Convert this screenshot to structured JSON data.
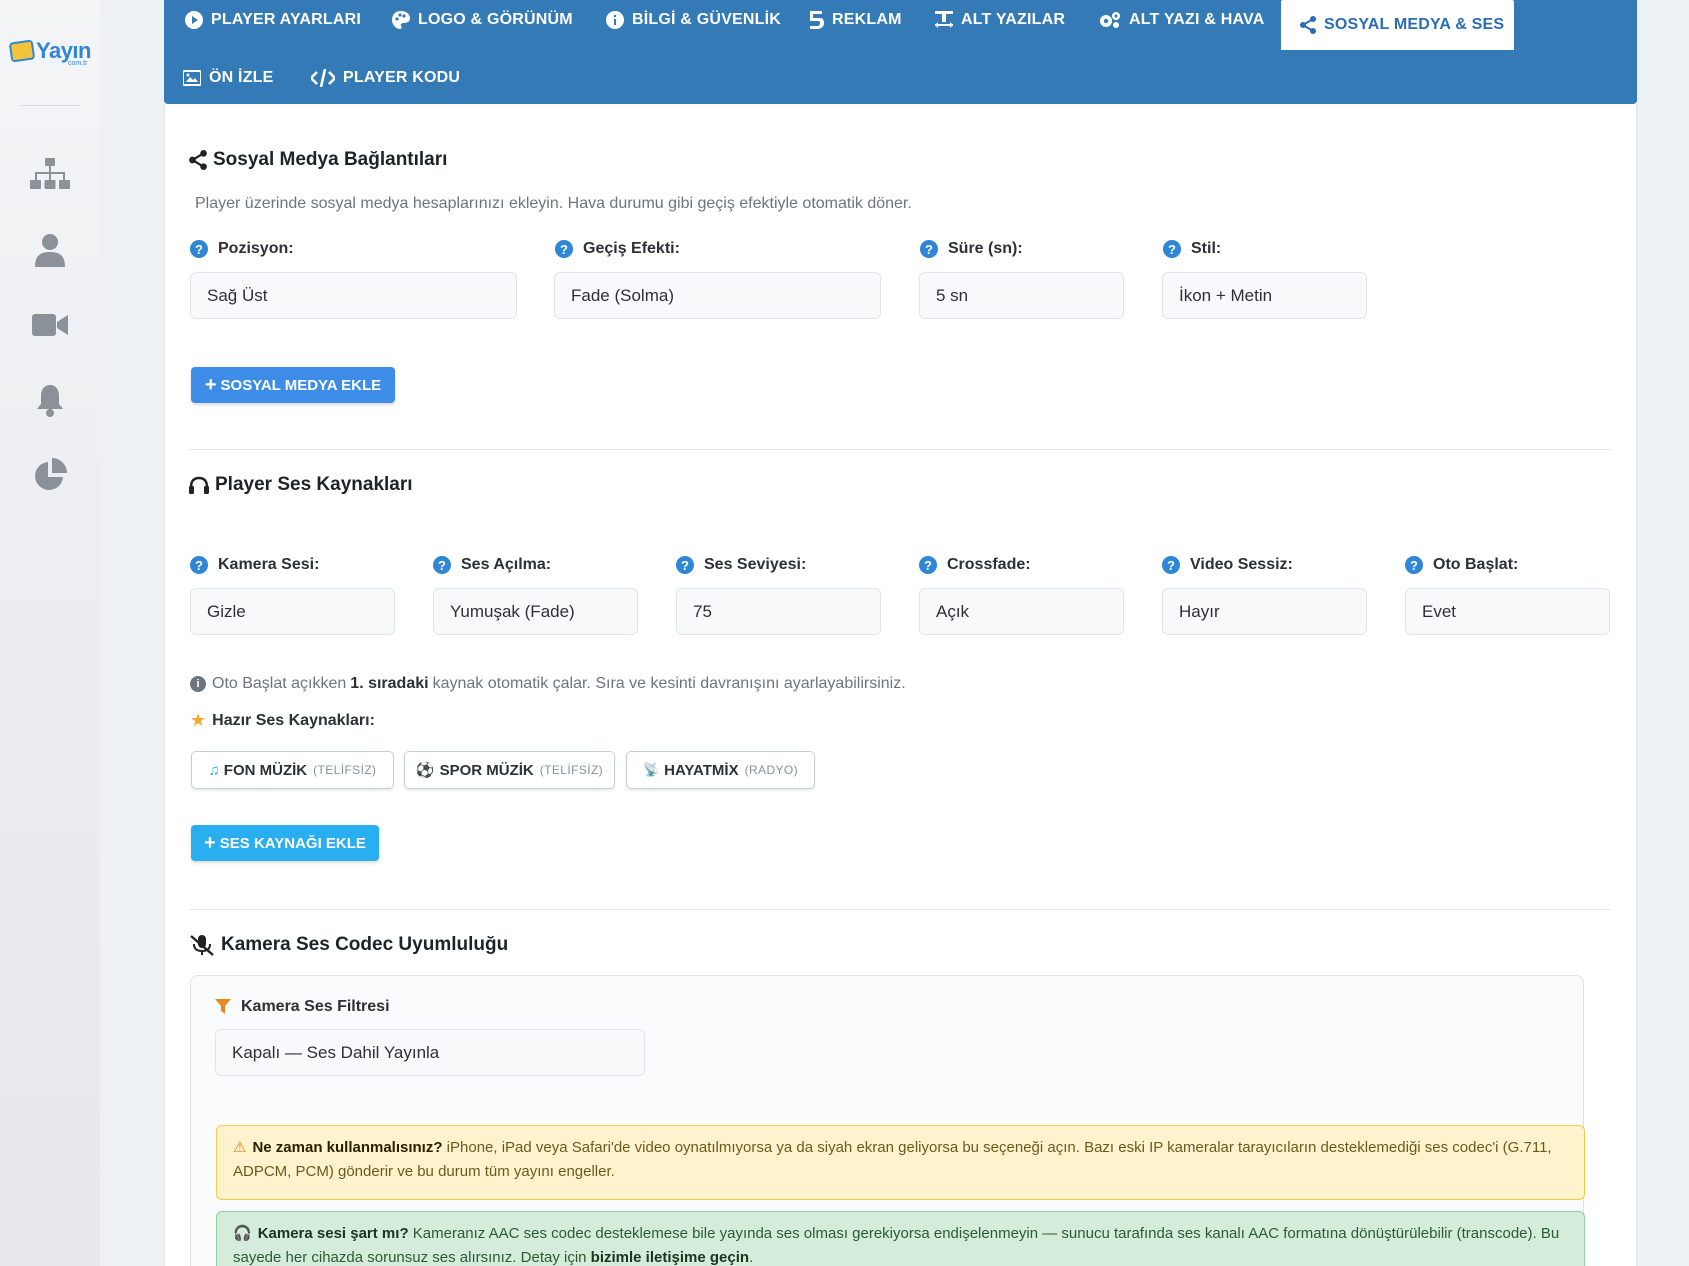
{
  "sidebar": {
    "logo_text": "Yayın",
    "logo_sub": "com.tr",
    "icons": [
      "sitemap-icon",
      "user-icon",
      "video-camera-icon",
      "bell-icon",
      "pie-chart-icon"
    ]
  },
  "tabs": [
    {
      "label": "PLAYER AYARLARI",
      "icon": "play-circle-icon"
    },
    {
      "label": "LOGO & GÖRÜNÜM",
      "icon": "palette-icon"
    },
    {
      "label": "BİLGİ & GÜVENLİK",
      "icon": "info-circle-icon"
    },
    {
      "label": "REKLAM",
      "icon": "ad-icon"
    },
    {
      "label": "ALT YAZILAR",
      "icon": "text-icon"
    },
    {
      "label": "ALT YAZI & HAVA",
      "icon": "cogs-icon"
    },
    {
      "label": "SOSYAL MEDYA & SES",
      "icon": "share-icon",
      "active": true
    },
    {
      "label": "ÖN İZLE",
      "icon": "image-icon"
    },
    {
      "label": "PLAYER KODU",
      "icon": "code-icon"
    }
  ],
  "social": {
    "title": "Sosyal Medya Bağlantıları",
    "description": "Player üzerinde sosyal medya hesaplarınızı ekleyin. Hava durumu gibi geçiş efektiyle otomatik döner.",
    "fields": [
      {
        "label": "Pozisyon:",
        "value": "Sağ Üst"
      },
      {
        "label": "Geçiş Efekti:",
        "value": "Fade (Solma)"
      },
      {
        "label": "Süre (sn):",
        "value": "5 sn"
      },
      {
        "label": "Stil:",
        "value": "İkon + Metin"
      }
    ],
    "add_button": "SOSYAL MEDYA EKLE"
  },
  "audio": {
    "title": "Player Ses Kaynakları",
    "fields": [
      {
        "label": "Kamera Sesi:",
        "value": "Gizle"
      },
      {
        "label": "Ses Açılma:",
        "value": "Yumuşak (Fade)"
      },
      {
        "label": "Ses Seviyesi:",
        "value": "75"
      },
      {
        "label": "Crossfade:",
        "value": "Açık"
      },
      {
        "label": "Video Sessiz:",
        "value": "Hayır"
      },
      {
        "label": "Oto Başlat:",
        "value": "Evet"
      }
    ],
    "info_pre": "Oto Başlat açıkken",
    "info_bold": "1. sıradaki",
    "info_post": "kaynak otomatik çalar. Sıra ve kesinti davranışını ayarlayabilirsiniz.",
    "presets_label": "Hazır Ses Kaynakları:",
    "presets": [
      {
        "label": "FON MÜZİK",
        "tag": "(TELİFSİZ)"
      },
      {
        "label": "SPOR MÜZİK",
        "tag": "(TELİFSİZ)"
      },
      {
        "label": "HAYATMİX",
        "tag": "(RADYO)"
      }
    ],
    "add_button": "SES KAYNAĞI EKLE"
  },
  "codec": {
    "title": "Kamera Ses Codec Uyumluluğu",
    "filter_title": "Kamera Ses Filtresi",
    "filter_value": "Kapalı — Ses Dahil Yayınla",
    "warning_bold": "Ne zaman kullanmalısınız?",
    "warning_text": " iPhone, iPad veya Safari'de video oynatılmıyorsa ya da siyah ekran geliyorsa bu seçeneği açın. Bazı eski IP kameralar tarayıcıların desteklemediği ses codec'i (G.711, ADPCM, PCM) gönderir ve bu durum tüm yayını engeller.",
    "success_bold": "Kamera sesi şart mı?",
    "success_text": " Kameranız AAC ses codec desteklemese bile yayında ses olması gerekiyorsa endişelenmeyin — sunucu tarafında ses kanalı AAC formatına dönüştürülebilir (transcode). Bu sayede her cihazda sorunsuz ses alırsınız. Detay için ",
    "success_link": "bizimle iletişime geçin",
    "success_end": "."
  },
  "colors": {
    "tab_bar": "#337ab7",
    "primary": "#3d8de8",
    "info": "#29aef0",
    "warning_bg": "#fff3cd",
    "success_bg": "#d4edda"
  }
}
